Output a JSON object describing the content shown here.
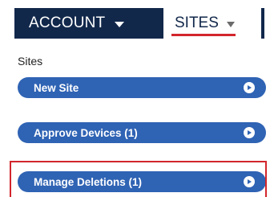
{
  "nav": {
    "account_label": "ACCOUNT",
    "sites_label": "SITES"
  },
  "section": {
    "label": "Sites"
  },
  "menu": {
    "items": [
      {
        "label": "New Site"
      },
      {
        "label": "Approve Devices (1)"
      },
      {
        "label": "Manage Deletions (1)"
      }
    ]
  },
  "colors": {
    "nav_dark": "#12284b",
    "button_blue": "#2f63b4",
    "highlight_red": "#d2262c"
  }
}
